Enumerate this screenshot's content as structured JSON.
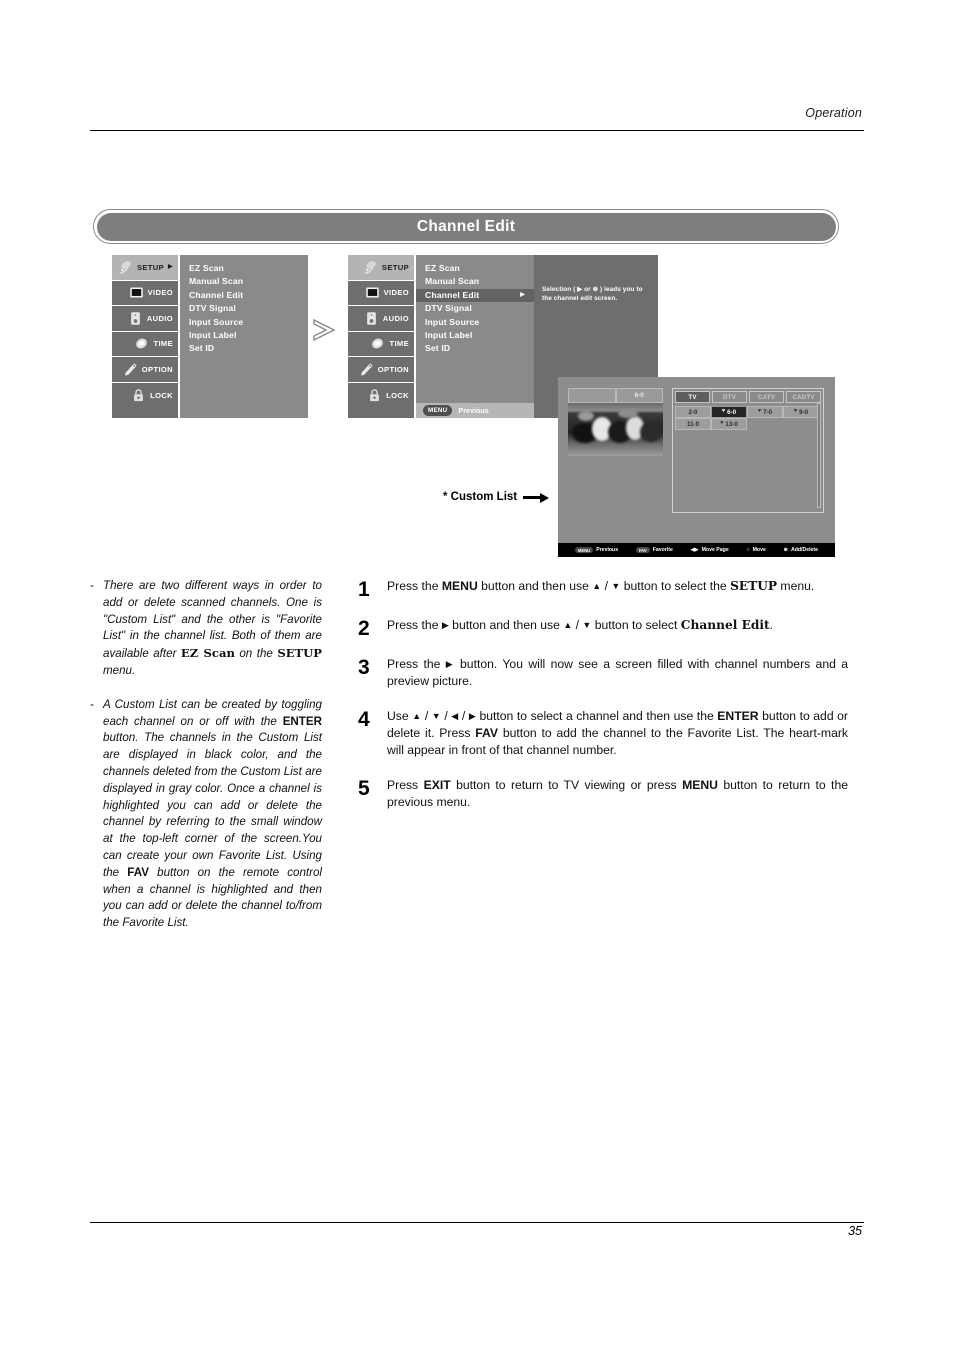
{
  "header": {
    "section": "Operation"
  },
  "footer": {
    "page_number": "35"
  },
  "title_bar": {
    "title": "Channel Edit"
  },
  "osd": {
    "sidebar": [
      {
        "label": "SETUP",
        "icon": "satellite-dish-icon",
        "selected": true,
        "caret": "▶"
      },
      {
        "label": "VIDEO",
        "icon": "monitor-icon",
        "selected": false,
        "caret": ""
      },
      {
        "label": "AUDIO",
        "icon": "speaker-icon",
        "selected": false,
        "caret": ""
      },
      {
        "label": "TIME",
        "icon": "clock-icon",
        "selected": false,
        "caret": ""
      },
      {
        "label": "OPTION",
        "icon": "tag-icon",
        "selected": false,
        "caret": ""
      },
      {
        "label": "LOCK",
        "icon": "padlock-icon",
        "selected": false,
        "caret": ""
      }
    ],
    "menu_items": [
      "EZ Scan",
      "Manual Scan",
      "Channel Edit",
      "DTV Signal",
      "Input Source",
      "Input Label",
      "Set ID"
    ],
    "highlighted_item": "Channel Edit",
    "highlight_caret": "▶",
    "description": "Selection ( ▶ or ⊛ ) leads you to the channel edit screen.",
    "bottom_bar": {
      "button": "MENU",
      "action": "Previous"
    },
    "flow_arrow": "double-chevron-right-icon"
  },
  "tv_screen": {
    "preview": {
      "blank_cell": "",
      "channel_label": "6-0",
      "image": "horse-racing-preview"
    },
    "tabs": [
      {
        "label": "TV",
        "active": true
      },
      {
        "label": "DTV",
        "active": false
      },
      {
        "label": "CATV",
        "active": false
      },
      {
        "label": "CADTV",
        "active": false
      }
    ],
    "channels": [
      {
        "number": "2-0",
        "favorite": false,
        "selected": false
      },
      {
        "number": "6-0",
        "favorite": true,
        "selected": true
      },
      {
        "number": "7-0",
        "favorite": true,
        "selected": false
      },
      {
        "number": "9-0",
        "favorite": true,
        "selected": false
      },
      {
        "number": "11-0",
        "favorite": false,
        "selected": false
      },
      {
        "number": "13-0",
        "favorite": true,
        "selected": false
      }
    ],
    "heart_glyph": "♥",
    "bottom_bar": [
      {
        "badge": "MENU",
        "glyph": "",
        "label": "Previous"
      },
      {
        "badge": "FAV",
        "glyph": "",
        "label": "Favorite"
      },
      {
        "badge": "",
        "glyph": "◀▶",
        "label": "Move Page"
      },
      {
        "badge": "",
        "glyph": "○",
        "label": "Move"
      },
      {
        "badge": "",
        "glyph": "⊛",
        "label": "Add/Delete"
      }
    ]
  },
  "custom_list_caption": {
    "label": "* Custom List",
    "arrow": "arrow-right-icon"
  },
  "notes": [
    {
      "dash": "-",
      "parts": [
        {
          "t": "There are two different ways in order to add or delete scanned channels. One is \"Custom List\" and the other is \"Favorite List\" in the channel list. Both of them are available after ",
          "style": "italic"
        },
        {
          "t": "EZ Scan",
          "style": "slab"
        },
        {
          "t": " on the ",
          "style": "italic"
        },
        {
          "t": "SETUP",
          "style": "slab"
        },
        {
          "t": " menu.",
          "style": "italic"
        }
      ]
    },
    {
      "dash": "-",
      "parts": [
        {
          "t": "A Custom List can be created by toggling each channel on or off with the ",
          "style": "italic"
        },
        {
          "t": "ENTER",
          "style": "bold"
        },
        {
          "t": " button. The channels in the Custom List are displayed in black color, and the channels deleted from the Custom List are displayed in gray color. Once a channel is highlighted you can add or delete the channel by referring to the small window at the top-left corner of the screen.You can create your own Favorite List. Using the ",
          "style": "italic"
        },
        {
          "t": "FAV",
          "style": "bold"
        },
        {
          "t": " button on the remote control when a channel is highlighted and then you can add or delete the channel to/from the Favorite List.",
          "style": "italic"
        }
      ]
    }
  ],
  "steps": [
    {
      "num": "1",
      "parts": [
        {
          "t": "Press the ",
          "style": "normal"
        },
        {
          "t": "MENU",
          "style": "bold"
        },
        {
          "t": " button and then use ",
          "style": "normal"
        },
        {
          "t": "▲",
          "style": "glyph"
        },
        {
          "t": " / ",
          "style": "normal"
        },
        {
          "t": "▼",
          "style": "glyph"
        },
        {
          "t": " button to select the ",
          "style": "normal"
        },
        {
          "t": "SETUP",
          "style": "slab"
        },
        {
          "t": " menu.",
          "style": "normal"
        }
      ]
    },
    {
      "num": "2",
      "parts": [
        {
          "t": "Press the ",
          "style": "normal"
        },
        {
          "t": "▶",
          "style": "glyph"
        },
        {
          "t": " button and then use ",
          "style": "normal"
        },
        {
          "t": "▲",
          "style": "glyph"
        },
        {
          "t": " / ",
          "style": "normal"
        },
        {
          "t": "▼",
          "style": "glyph"
        },
        {
          "t": " button to select ",
          "style": "normal"
        },
        {
          "t": "Channel Edit",
          "style": "slab"
        },
        {
          "t": ".",
          "style": "normal"
        }
      ]
    },
    {
      "num": "3",
      "parts": [
        {
          "t": "Press the ",
          "style": "normal"
        },
        {
          "t": "▶",
          "style": "glyph"
        },
        {
          "t": " button. You will now see a screen filled with channel numbers and a preview picture.",
          "style": "normal"
        }
      ]
    },
    {
      "num": "4",
      "parts": [
        {
          "t": "Use ",
          "style": "normal"
        },
        {
          "t": "▲",
          "style": "glyph"
        },
        {
          "t": " / ",
          "style": "normal"
        },
        {
          "t": "▼",
          "style": "glyph"
        },
        {
          "t": " / ",
          "style": "normal"
        },
        {
          "t": "◀",
          "style": "glyph"
        },
        {
          "t": " / ",
          "style": "normal"
        },
        {
          "t": "▶",
          "style": "glyph"
        },
        {
          "t": " button to select a channel and then use the ",
          "style": "normal"
        },
        {
          "t": "ENTER",
          "style": "bold"
        },
        {
          "t": " button to add or delete it. Press ",
          "style": "normal"
        },
        {
          "t": "FAV",
          "style": "bold"
        },
        {
          "t": " button to add the channel to the Favorite List. The heart-mark will appear in front of that channel number.",
          "style": "normal"
        }
      ]
    },
    {
      "num": "5",
      "parts": [
        {
          "t": "Press ",
          "style": "normal"
        },
        {
          "t": "EXIT",
          "style": "bold"
        },
        {
          "t": " button to return to TV viewing or press ",
          "style": "normal"
        },
        {
          "t": "MENU",
          "style": "bold"
        },
        {
          "t": " button to return to the previous menu.",
          "style": "normal"
        }
      ]
    }
  ],
  "colors": {
    "title_bar_bg": "#7e7e7e",
    "osd_sidebar_bg": "#6e6e6e",
    "osd_list_bg": "#8a8a8a",
    "osd_selected_bg": "#b4b4b4",
    "osd_highlight_bg": "#636363",
    "tv_screen_bg": "#8d8d8d",
    "tv_bottom_bar_bg": "#000000",
    "selected_channel_bg": "#252525"
  }
}
